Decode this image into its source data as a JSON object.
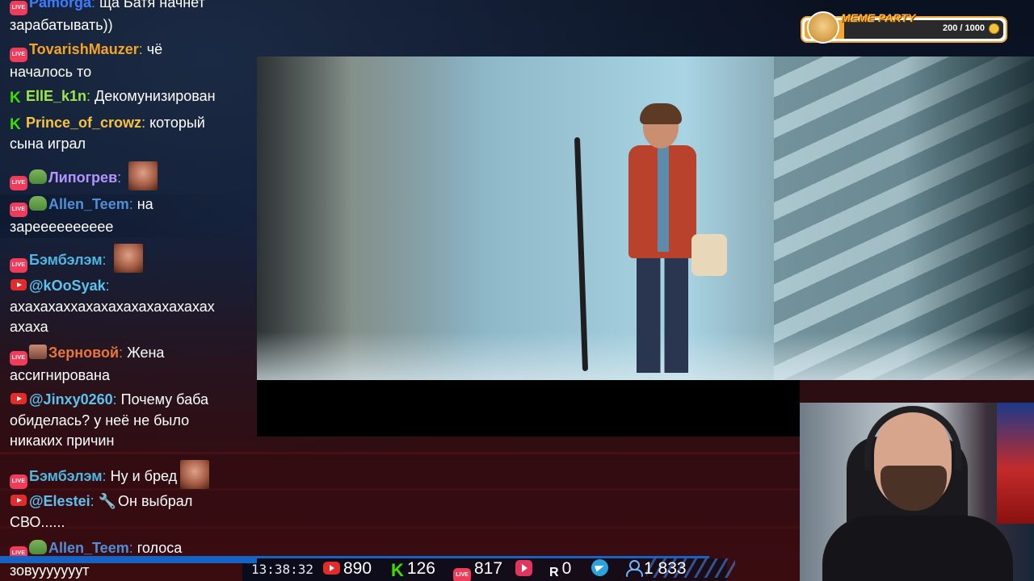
{
  "meme_party": {
    "title": "MEME PARTY",
    "count": "200 / 1000",
    "progress": 0.2,
    "accent": "#f7a531"
  },
  "chat": [
    {
      "badges": [
        "live"
      ],
      "name": "Pamorga",
      "name_color": "#3d7cff",
      "text": "ща Батя начнет",
      "text2": "зарабатывать))"
    },
    {
      "badges": [
        "live"
      ],
      "name": "TovarishMauzer",
      "name_color": "#f5a524",
      "text": "чё",
      "text2": "началось то"
    },
    {
      "badges": [
        "kick"
      ],
      "name": "EllE_k1n",
      "name_color": "#9be84a",
      "text": "Декомунизирован"
    },
    {
      "badges": [
        "kick"
      ],
      "name": "Prince_of_crowz",
      "name_color": "#f5c344",
      "text": "который",
      "text2": "сына играл"
    },
    {
      "badges": [
        "live",
        "pepe"
      ],
      "name": "Липогрев",
      "name_color": "#b495ff",
      "text": "",
      "emote": true
    },
    {
      "badges": [
        "live",
        "pepe"
      ],
      "name": "Allen_Teem",
      "name_color": "#4f8fd8",
      "text": "на",
      "text2": "зарееееееееее"
    },
    {
      "badges": [
        "live"
      ],
      "name": "Бэмбэлэм",
      "name_color": "#4fb6e0",
      "text": "",
      "emote": true
    },
    {
      "badges": [
        "yt"
      ],
      "name": "@kOoSyak",
      "name_color": "#5cc2f0",
      "text": "",
      "text2": "ахахахаххахахахахахахахахах",
      "text3": "ахаха"
    },
    {
      "badges": [
        "live",
        "face"
      ],
      "name": "Зерновой",
      "name_color": "#e8753a",
      "text": "Жена",
      "text2": "ассигнирована"
    },
    {
      "badges": [
        "yt"
      ],
      "name": "@Jinxy0260",
      "name_color": "#5cc2f0",
      "text": "Почему баба",
      "text2": "обиделась? у неё не было",
      "text3": "никаких причин"
    },
    {
      "badges": [
        "live"
      ],
      "name": "Бэмбэлэм",
      "name_color": "#4fb6e0",
      "text": "Ну и бред",
      "emote": true
    },
    {
      "badges": [
        "yt"
      ],
      "name": "@Elestei",
      "name_color": "#5cc2f0",
      "text": "Он выбрал",
      "text2": "СВО......",
      "wrench": true
    },
    {
      "badges": [
        "live",
        "pepe"
      ],
      "name": "Allen_Teem",
      "name_color": "#4f8fd8",
      "text": "голоса",
      "text2": "зовууууууут"
    }
  ],
  "status": {
    "time": "13:38:32",
    "youtube": "890",
    "kick": "126",
    "live": "817",
    "rutube": "0",
    "viewers": "1 833",
    "live_label": "LIVE",
    "kick_label": "K",
    "r_label": "R"
  },
  "colors": {
    "accent_blue": "#1563c4",
    "live_pink": "#f03c5a",
    "kick_green": "#39e000",
    "yt_red": "#e42b2b"
  }
}
